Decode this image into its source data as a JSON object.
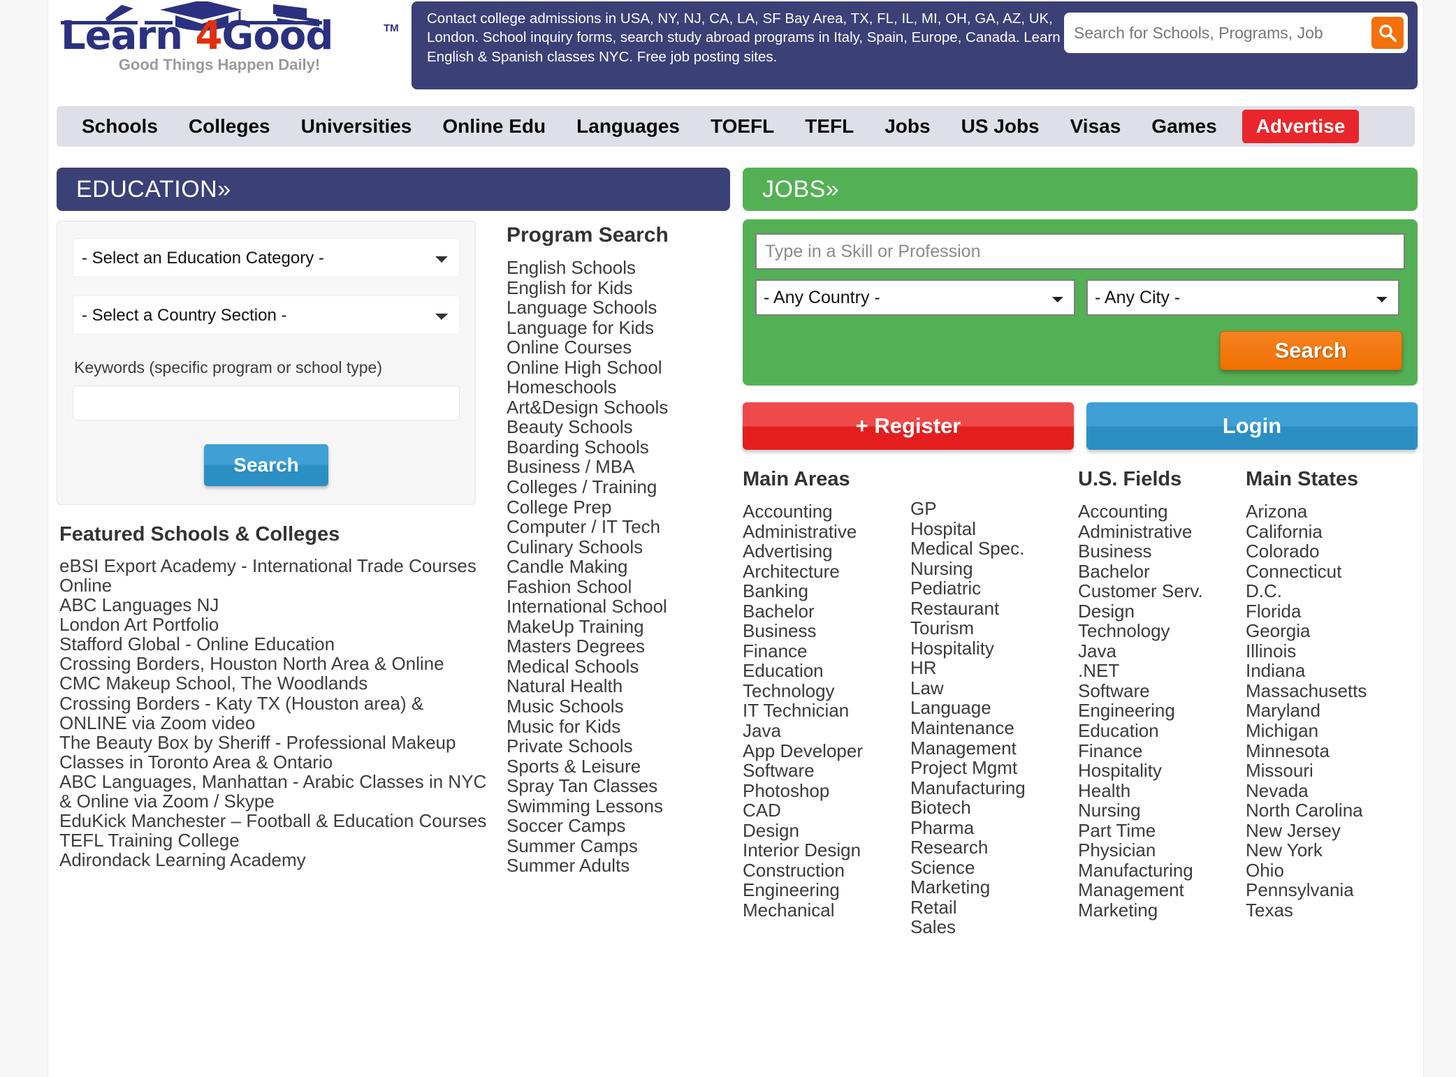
{
  "header": {
    "logo": {
      "word1": "Learn",
      "word2": "4",
      "word3": "Good",
      "tm": "TM",
      "tagline": "Good Things Happen Daily!"
    },
    "banner_text": "Contact college admissions in USA, NY, NJ, CA, LA, SF Bay Area, TX, FL, IL, MI, OH, GA, AZ, UK, London. School inquiry forms, search study abroad programs in Italy, Spain, Europe, Canada. Learn English & Spanish classes NYC. Free job posting sites.",
    "search_placeholder": "Search for Schools, Programs, Job",
    "search_value": ""
  },
  "nav": {
    "items": [
      "Schools",
      "Colleges",
      "Universities",
      "Online Edu",
      "Languages",
      "TOEFL",
      "TEFL",
      "Jobs",
      "US Jobs",
      "Visas",
      "Games"
    ],
    "advertise": "Advertise"
  },
  "education": {
    "panel_title": "EDUCATION»",
    "category_select": "- Select an Education Category -",
    "country_select": "- Select a Country Section -",
    "keywords_label": "Keywords (specific program or school type)",
    "keywords_value": "",
    "search_button": "Search",
    "featured_title": "Featured Schools & Colleges",
    "featured": [
      "eBSI Export Academy - International Trade Courses Online",
      "ABC Languages NJ",
      "London Art Portfolio",
      "Stafford Global - Online Education",
      "Crossing Borders, Houston North Area & Online",
      "CMC Makeup School, The Woodlands",
      "Crossing Borders - Katy TX (Houston area) & ONLINE via Zoom video",
      "The Beauty Box by Sheriff - Professional Makeup Classes in Toronto Area & Ontario",
      "ABC Languages, Manhattan - Arabic Classes in NYC & Online via Zoom / Skype",
      "EduKick Manchester – Football & Education Courses",
      "TEFL Training College",
      "Adirondack Learning Academy"
    ]
  },
  "program_search": {
    "title": "Program Search",
    "items": [
      "English Schools",
      "English for Kids",
      "Language Schools",
      "Language for Kids",
      "Online Courses",
      "Online High School",
      "Homeschools",
      "Art&Design Schools",
      "Beauty Schools",
      "Boarding Schools",
      "Business / MBA",
      "Colleges / Training",
      "College Prep",
      "Computer / IT Tech",
      "Culinary Schools",
      "Candle Making",
      "Fashion School",
      "International School",
      "MakeUp Training",
      "Masters Degrees",
      "Medical Schools",
      "Natural Health",
      "Music Schools",
      "Music for Kids",
      "Private Schools",
      "Sports & Leisure",
      "Spray Tan Classes",
      "Swimming Lessons",
      "Soccer Camps",
      "Summer Camps",
      "Summer Adults"
    ]
  },
  "jobs": {
    "panel_title": "JOBS»",
    "skill_placeholder": "Type in a Skill or Profession",
    "skill_value": "",
    "country_select": "- Any Country -",
    "city_select": "- Any City -",
    "search_button": "Search",
    "register_button": "+ Register",
    "login_button": "Login",
    "columns": [
      {
        "title": "Main Areas",
        "items": [
          "Accounting",
          "Administrative",
          "Advertising",
          "Architecture",
          "Banking",
          "Bachelor",
          "Business",
          "Finance",
          "Education",
          "Technology",
          "IT Technician",
          "Java",
          "App Developer",
          "Software",
          "Photoshop",
          "CAD",
          "Design",
          "Interior Design",
          "Construction",
          "Engineering",
          "Mechanical"
        ]
      },
      {
        "title": "",
        "items": [
          "GP",
          "Hospital",
          "Medical Spec.",
          "Nursing",
          "Pediatric",
          "Restaurant",
          "Tourism",
          "Hospitality",
          "HR",
          "Law",
          "Language",
          "Maintenance",
          "Management",
          "Project Mgmt",
          "Manufacturing",
          "Biotech",
          "Pharma",
          "Research",
          "Science",
          "Marketing",
          "Retail",
          "Sales"
        ]
      },
      {
        "title": "U.S. Fields",
        "items": [
          "Accounting",
          "Administrative",
          "Business",
          "Bachelor",
          "Customer Serv.",
          "Design",
          "Technology",
          "Java",
          ".NET",
          "Software",
          "Engineering",
          "Education",
          "Finance",
          "Hospitality",
          "Health",
          "Nursing",
          "Part Time",
          "Physician",
          "Manufacturing",
          "Management",
          "Marketing"
        ]
      },
      {
        "title": "Main States",
        "items": [
          "Arizona",
          "California",
          "Colorado",
          "Connecticut",
          "D.C.",
          "Florida",
          "Georgia",
          "Illinois",
          "Indiana",
          "Massachusetts",
          "Maryland",
          "Michigan",
          "Minnesota",
          "Missouri",
          "Nevada",
          "North Carolina",
          "New Jersey",
          "New York",
          "Ohio",
          "Pennsylvania",
          "Texas"
        ]
      }
    ]
  },
  "colors": {
    "brand_navy": "#3b4077",
    "brand_red": "#e03010",
    "jobs_green": "#54b054",
    "orange": "#f3700b",
    "nav_bg": "#dedfe7",
    "advertise_red": "#e8262b",
    "blue_button": "#3ea0d4"
  }
}
